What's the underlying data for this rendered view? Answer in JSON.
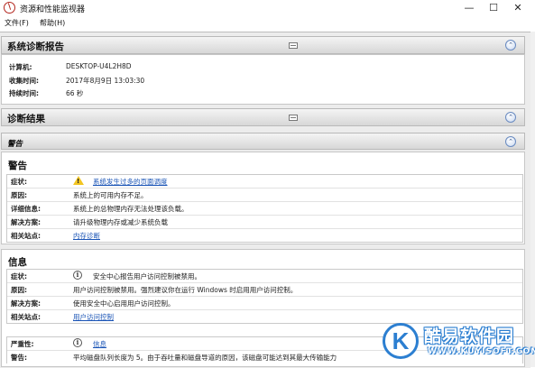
{
  "window": {
    "title": "资源和性能监视器",
    "controls": [
      "—",
      "☐",
      "✕"
    ]
  },
  "menu": [
    {
      "label": "文件(F)"
    },
    {
      "label": "帮助(H)"
    }
  ],
  "report": {
    "title": "系统诊断报告",
    "collapse_glyph": "⌃",
    "fields": [
      {
        "key": "计算机:",
        "value": "DESKTOP-U4L2H8D"
      },
      {
        "key": "收集时间:",
        "value": "2017年8月9日  13:03:30"
      },
      {
        "key": "持续时间:",
        "value": "66 秒"
      }
    ]
  },
  "results": {
    "title": "诊断结果",
    "warning_band": "警告"
  },
  "warning": {
    "title": "警告",
    "rows": [
      {
        "key": "症状:",
        "value": "系统发生过多的页面调度",
        "icon": "warning-icon",
        "link": true
      },
      {
        "key": "原因:",
        "value": "系统上的可用内存不足。"
      },
      {
        "key": "详细信息:",
        "value": "系统上的总物理内存无法处理该负载。"
      },
      {
        "key": "解决方案:",
        "value": "请升级物理内存或减少系统负载"
      },
      {
        "key": "相关站点:",
        "value": "内存诊断",
        "link": true
      }
    ]
  },
  "info": {
    "title": "信息",
    "rows": [
      {
        "key": "症状:",
        "value": "安全中心报告用户访问控制被禁用。",
        "icon": "info-icon"
      },
      {
        "key": "原因:",
        "value": "用户访问控制被禁用。强烈建议你在运行  Windows 时启用用户访问控制。"
      },
      {
        "key": "解决方案:",
        "value": "使用安全中心启用用户访问控制。"
      },
      {
        "key": "相关站点:",
        "value": "用户访问控制",
        "link": true
      }
    ],
    "rows2": [
      {
        "key": "严重性:",
        "value": "信息",
        "icon": "info-icon",
        "link": true
      },
      {
        "key": "警告:",
        "value": "平均磁盘队列长度为  5。由于吞吐量和磁盘导道的原因，该磁盘可能达到其最大传输能力"
      }
    ]
  },
  "watermark": {
    "logo": "K",
    "name": "酷易软件园",
    "url": "WWW.KUYISOFT.COM"
  }
}
